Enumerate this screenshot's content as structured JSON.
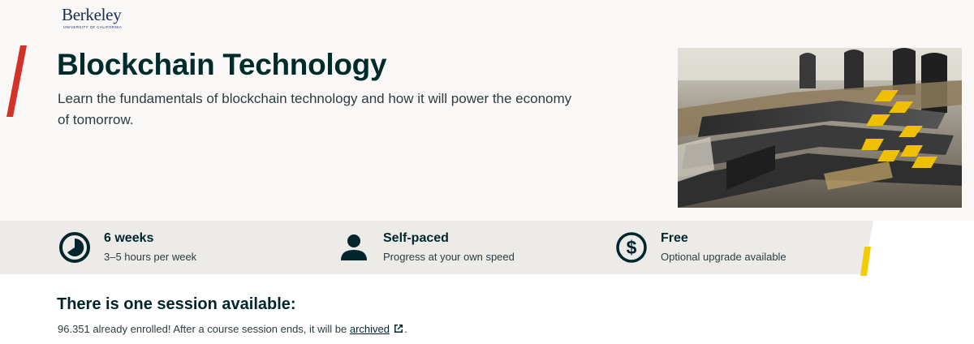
{
  "brand": {
    "logo_word": "Berkeley",
    "logo_sub": "UNIVERSITY OF CALIFORNIA"
  },
  "course": {
    "title": "Blockchain Technology",
    "subtitle": "Learn the fundamentals of blockchain technology and how it will power the economy of tomorrow.",
    "image_icon": "blockchain-mining-rigs-image"
  },
  "stats": [
    {
      "icon": "clock-icon",
      "title": "6 weeks",
      "desc": "3–5 hours per week"
    },
    {
      "icon": "person-icon",
      "title": "Self-paced",
      "desc": "Progress at your own speed"
    },
    {
      "icon": "dollar-icon",
      "title": "Free",
      "desc": "Optional upgrade available"
    }
  ],
  "session": {
    "heading": "There is one session available:",
    "enroll_text": "96.351 already enrolled! After a course session ends, it will be ",
    "archived_link": "archived",
    "trailing": "."
  },
  "colors": {
    "accent_red": "#d23228",
    "accent_yellow": "#f0cc00",
    "stats_band": "#ecebe8",
    "hero_bg": "#f9f8f7",
    "ink": "#00262b"
  }
}
